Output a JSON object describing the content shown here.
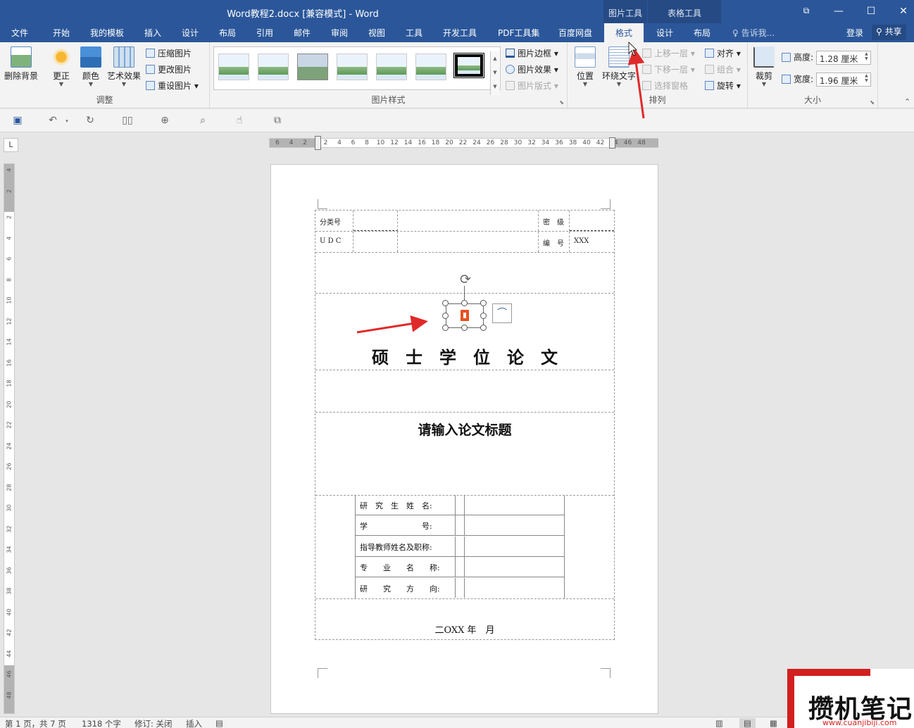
{
  "window": {
    "title": "Word教程2.docx [兼容模式] - Word",
    "context_picture_tools": "图片工具",
    "context_table_tools": "表格工具",
    "btn_restore": "⧉",
    "btn_min": "—",
    "btn_max": "☐",
    "btn_close": "✕"
  },
  "tabs": {
    "file": "文件",
    "home": "开始",
    "templates": "我的模板",
    "insert": "插入",
    "design": "设计",
    "layout": "布局",
    "references": "引用",
    "mailings": "邮件",
    "review": "审阅",
    "view": "视图",
    "tools": "工具",
    "developer": "开发工具",
    "pdf": "PDF工具集",
    "baidu": "百度网盘",
    "format": "格式",
    "tbl_design": "设计",
    "tbl_layout": "布局",
    "tell_me": "告诉我...",
    "login": "登录",
    "share": "共享"
  },
  "ribbon": {
    "adjust": {
      "label": "调整",
      "remove_bg": "删除背景",
      "corrections": "更正",
      "color": "颜色",
      "artistic": "艺术效果",
      "compress": "压缩图片",
      "change": "更改图片",
      "reset": "重设图片"
    },
    "styles": {
      "label": "图片样式",
      "border": "图片边框",
      "effects": "图片效果",
      "layout": "图片版式"
    },
    "arrange": {
      "label": "排列",
      "position": "位置",
      "wrap": "环绕文字",
      "forward": "上移一层",
      "backward": "下移一层",
      "pane": "选择窗格",
      "align": "对齐",
      "group": "组合",
      "rotate": "旋转"
    },
    "size": {
      "label": "大小",
      "crop": "裁剪",
      "height_label": "高度:",
      "height_value": "1.28 厘米",
      "width_label": "宽度:",
      "width_value": "1.96 厘米"
    }
  },
  "ruler": {
    "h_ticks": [
      "6",
      "4",
      "2",
      "2",
      "4",
      "6",
      "8",
      "10",
      "12",
      "14",
      "16",
      "18",
      "20",
      "22",
      "24",
      "26",
      "28",
      "30",
      "32",
      "34",
      "36",
      "38",
      "40",
      "42",
      "44",
      "46",
      "48"
    ],
    "v_ticks": [
      "4",
      "2",
      "2",
      "4",
      "6",
      "8",
      "10",
      "12",
      "14",
      "16",
      "18",
      "20",
      "22",
      "24",
      "26",
      "28",
      "30",
      "32",
      "34",
      "36",
      "38",
      "40",
      "42",
      "44",
      "46",
      "48"
    ],
    "tab_stop": "L"
  },
  "document": {
    "class_no": "分类号",
    "secret": "密　级",
    "udc": "U D C",
    "number": "编　号",
    "number_value": "XXX",
    "degree_title": "硕　士　学　位　论　文",
    "thesis_title": "请输入论文标题",
    "fields": [
      {
        "label": "研　究　生　姓　名:"
      },
      {
        "label": "学　　　　　　　号:"
      },
      {
        "label": "指导教师姓名及职称:"
      },
      {
        "label": "专　　业　　名　　称:"
      },
      {
        "label": "研　　究　　方　　向:"
      }
    ],
    "date": "二OXX 年　月"
  },
  "status": {
    "page": "第 1 页，共 7 页",
    "words": "1318 个字",
    "track": "修订: 关闭",
    "mode": "插入"
  },
  "watermark": {
    "brand": "攒机笔记",
    "url": "www.cuanjibiji.com"
  },
  "colors": {
    "accent": "#2b579a",
    "arrow": "#e02a2a",
    "watermark_red": "#d21f1f"
  }
}
